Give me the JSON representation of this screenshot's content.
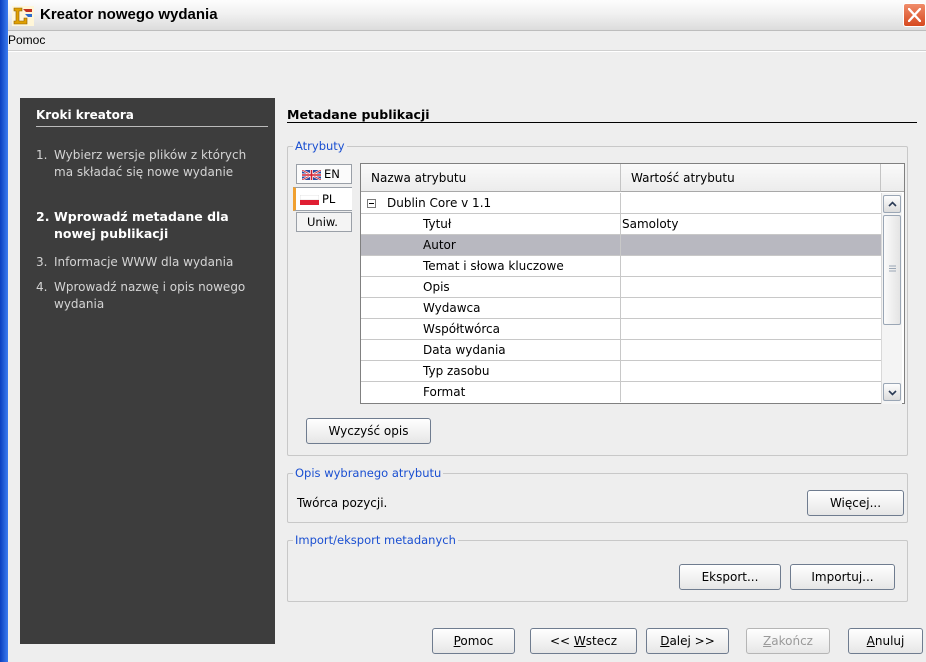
{
  "window": {
    "title": "Kreator nowego wydania",
    "icon": "wizard-app-icon",
    "close_icon": "close-x-icon"
  },
  "menu": {
    "items": [
      "Pomoc"
    ]
  },
  "steps_panel": {
    "title": "Kroki kreatora",
    "steps": [
      {
        "num": "1.",
        "text": "Wybierz wersje plików z których ma składać się nowe wydanie",
        "active": false
      },
      {
        "num": "2.",
        "text": "Wprowadź metadane dla nowej publikacji",
        "active": true
      },
      {
        "num": "3.",
        "text": "Informacje WWW dla wydania",
        "active": false
      },
      {
        "num": "4.",
        "text": "Wprowadź nazwę i opis nowego wydania",
        "active": false
      }
    ]
  },
  "section": {
    "title": "Metadane publikacji"
  },
  "attributes": {
    "legend": "Atrybuty",
    "tabs": [
      {
        "label": "EN",
        "flag": "uk-flag-icon"
      },
      {
        "label": "PL",
        "flag": "pl-flag-icon"
      },
      {
        "label": "Uniw."
      }
    ],
    "columns": [
      "Nazwa atrybutu",
      "Wartość atrybutu"
    ],
    "group_label": "Dublin Core v 1.1",
    "rows": [
      {
        "name": "Tytuł",
        "value": "Samoloty",
        "selected": false
      },
      {
        "name": "Autor",
        "value": "",
        "selected": true
      },
      {
        "name": "Temat i słowa kluczowe",
        "value": "",
        "selected": false
      },
      {
        "name": "Opis",
        "value": "",
        "selected": false
      },
      {
        "name": "Wydawca",
        "value": "",
        "selected": false
      },
      {
        "name": "Współtwórca",
        "value": "",
        "selected": false
      },
      {
        "name": "Data wydania",
        "value": "",
        "selected": false
      },
      {
        "name": "Typ zasobu",
        "value": "",
        "selected": false
      },
      {
        "name": "Format",
        "value": "",
        "selected": false
      }
    ],
    "clear_button": "Wyczyść opis"
  },
  "description": {
    "legend": "Opis wybranego atrybutu",
    "text": "Twórca pozycji.",
    "more_button": "Więcej..."
  },
  "import_export": {
    "legend": "Import/eksport metadanych",
    "export_button": "Eksport...",
    "import_button": "Importuj..."
  },
  "footer": {
    "help": {
      "u": "P",
      "rest": "omoc"
    },
    "back": {
      "pre": "<< ",
      "u": "W",
      "rest": "stecz"
    },
    "next": {
      "u": "D",
      "rest": "alej >>"
    },
    "finish": {
      "u": "Z",
      "rest": "akończ"
    },
    "cancel": {
      "u": "A",
      "rest": "nuluj"
    }
  },
  "colors": {
    "steps_bg": "#3d3d3d",
    "legend_text": "#1a4fd1",
    "selected_row": "#b8b8c0",
    "dialog_bg": "#eeeeee"
  }
}
